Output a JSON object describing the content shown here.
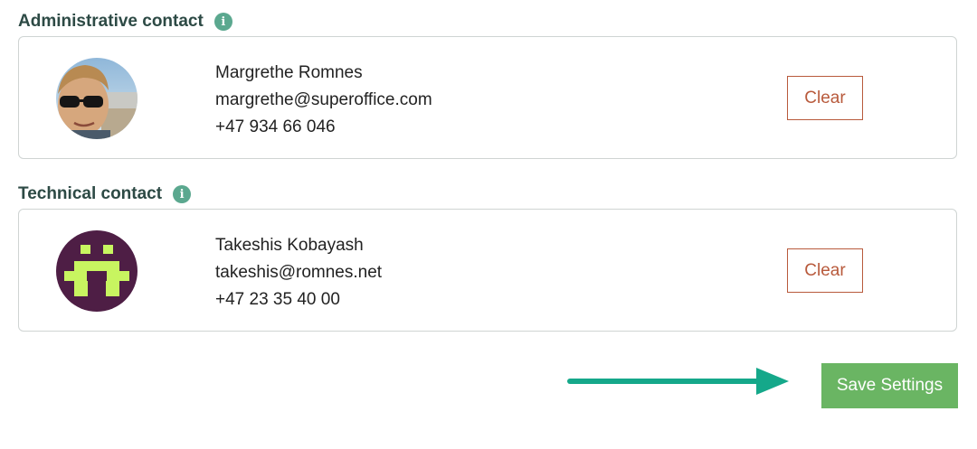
{
  "admin_section": {
    "title": "Administrative contact",
    "info_icon": "i",
    "contact": {
      "name": "Margrethe Romnes",
      "email": "margrethe@superoffice.com",
      "phone": "+47 934 66 046",
      "avatar": "photo-avatar"
    },
    "clear_label": "Clear"
  },
  "technical_section": {
    "title": "Technical contact",
    "info_icon": "i",
    "contact": {
      "name": "Takeshis Kobayash",
      "email": "takeshis@romnes.net",
      "phone": "+47 23 35 40 00",
      "avatar": "pixel-avatar"
    },
    "clear_label": "Clear"
  },
  "footer": {
    "save_label": "Save Settings"
  },
  "colors": {
    "heading": "#2d4a45",
    "info_icon": "#5ba88f",
    "clear_accent": "#b85a3c",
    "save_button": "#6ab563",
    "arrow": "#15a88a",
    "pixel_avatar_bg": "#4e1e45",
    "pixel_avatar_fg": "#c8f560"
  }
}
